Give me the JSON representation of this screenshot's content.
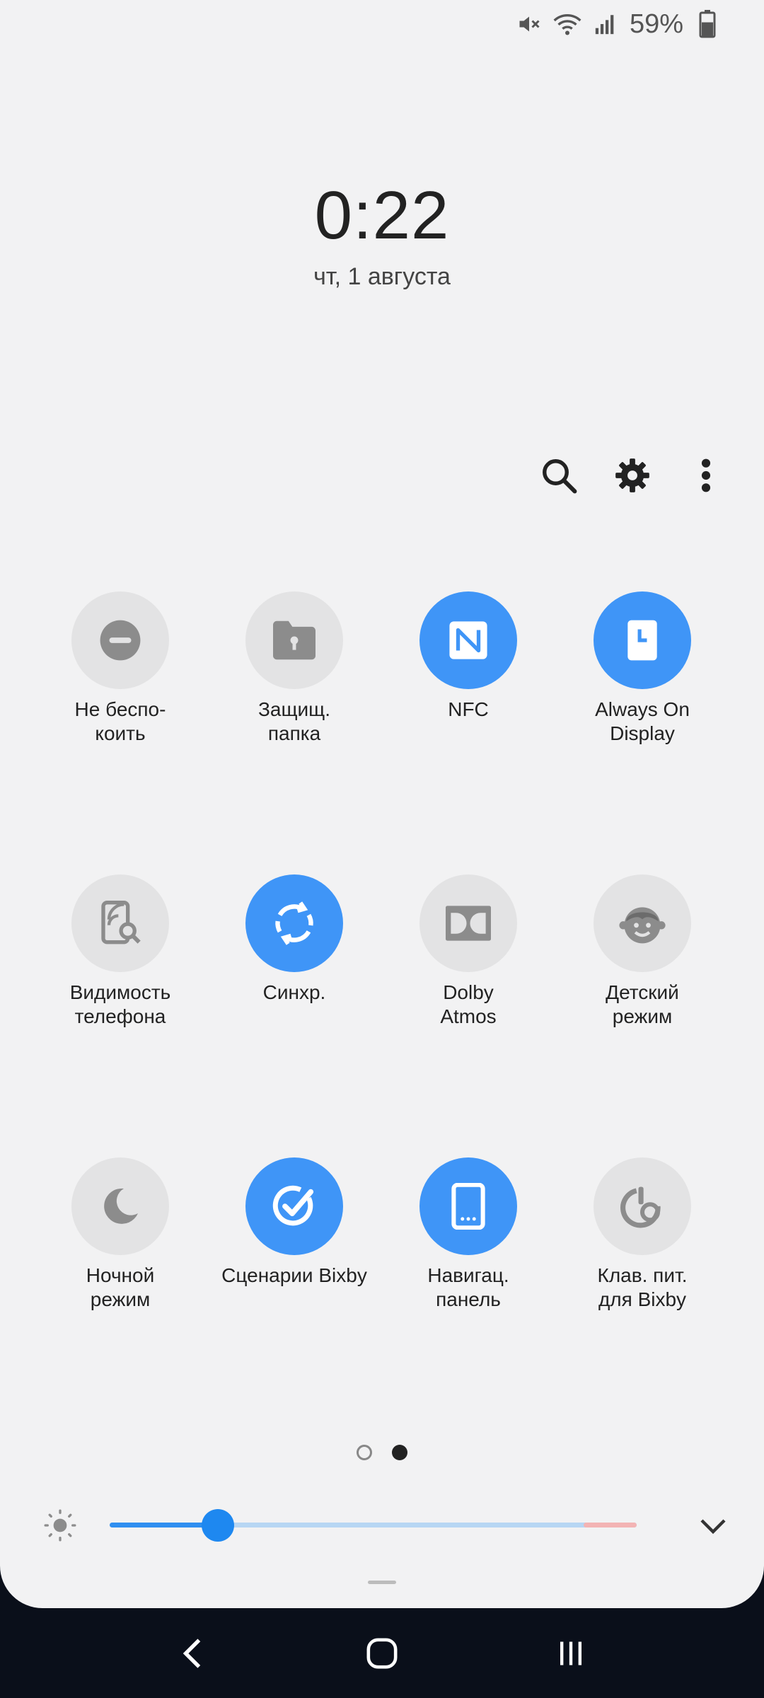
{
  "status_bar": {
    "battery_text": "59%",
    "battery_level": 0.59,
    "icons": [
      "mute-icon",
      "wifi-icon",
      "signal-icon",
      "battery-icon"
    ]
  },
  "lockscreen": {
    "time": "0:22",
    "date": "чт, 1 августа"
  },
  "top_actions": [
    "search-icon",
    "gear-icon",
    "more-vert-icon"
  ],
  "tiles": [
    {
      "label": "Не беспо-\nкоить",
      "icon": "do-not-disturb-icon",
      "on": false
    },
    {
      "label": "Защищ.\nпапка",
      "icon": "secure-folder-icon",
      "on": false
    },
    {
      "label": "NFC",
      "icon": "nfc-icon",
      "on": true
    },
    {
      "label": "Always On\nDisplay",
      "icon": "always-on-display-icon",
      "on": true
    },
    {
      "label": "Видимость\nтелефона",
      "icon": "phone-visibility-icon",
      "on": false
    },
    {
      "label": "Синхр.",
      "icon": "sync-icon",
      "on": true
    },
    {
      "label": "Dolby\nAtmos",
      "icon": "dolby-icon",
      "on": false
    },
    {
      "label": "Детский\nрежим",
      "icon": "kids-mode-icon",
      "on": false
    },
    {
      "label": "Ночной\nрежим",
      "icon": "night-mode-icon",
      "on": false
    },
    {
      "label": "Сценарии Bixby",
      "icon": "bixby-routines-icon",
      "on": true
    },
    {
      "label": "Навигац.\nпанель",
      "icon": "navigation-bar-icon",
      "on": true
    },
    {
      "label": "Клав. пит.\nдля Bixby",
      "icon": "bixby-key-icon",
      "on": false
    }
  ],
  "pagination": {
    "current": 2,
    "total": 2
  },
  "brightness": {
    "level": 0.205
  },
  "colors": {
    "accent": "#3f95f7",
    "tile_off": "#e3e3e4",
    "panel_bg": "#f2f2f3"
  },
  "navbar": [
    "back-icon",
    "home-icon",
    "recents-icon"
  ]
}
